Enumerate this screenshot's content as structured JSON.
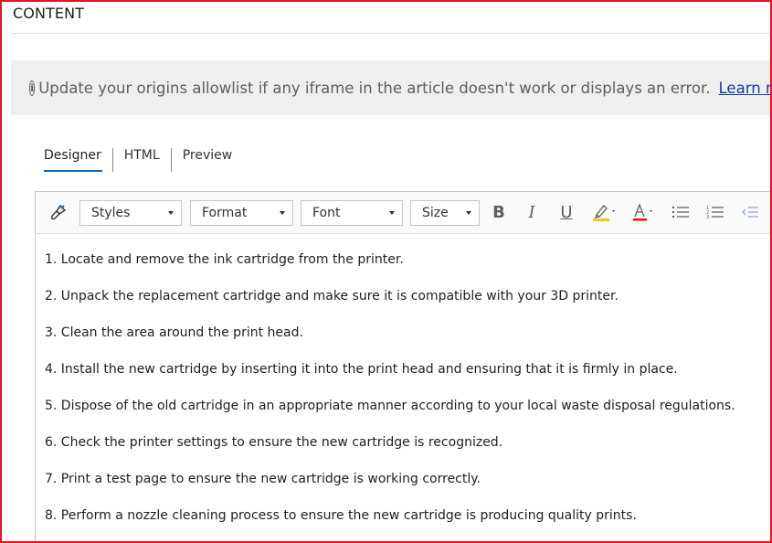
{
  "section": {
    "title": "CONTENT"
  },
  "info_bar": {
    "icon": "info-icon",
    "message": "Update your origins allowlist if any iframe in the article doesn't work or displays an error.",
    "link_text": "Learn more",
    "trailing": "."
  },
  "tabs": [
    {
      "label": "Designer",
      "active": true
    },
    {
      "label": "HTML",
      "active": false
    },
    {
      "label": "Preview",
      "active": false
    }
  ],
  "toolbar": {
    "format_painter_icon": "brush-icon",
    "styles_label": "Styles",
    "format_label": "Format",
    "font_label": "Font",
    "size_label": "Size",
    "bold_label": "B",
    "italic_label": "I",
    "underline_label": "U",
    "highlight_icon": "highlight-icon",
    "font_color_label": "A",
    "bulleted_list_icon": "bulleted-list-icon",
    "numbered_list_icon": "numbered-list-icon",
    "decrease_indent_icon": "decrease-indent-icon",
    "highlight_color": "#f2c811",
    "font_color": "#e81123"
  },
  "content": {
    "lines": [
      "1. Locate and remove the ink cartridge from the printer.",
      "2. Unpack the replacement cartridge and make sure it is compatible with your 3D printer.",
      "3. Clean the area around the print head.",
      "4. Install the new cartridge by inserting it into the print head and ensuring that it is firmly in place.",
      "5. Dispose of the old cartridge in an appropriate manner according to your local waste disposal regulations.",
      "6. Check the printer settings to ensure the new cartridge is recognized.",
      "7. Print a test page to ensure the new cartridge is working correctly.",
      "8. Perform a nozzle cleaning process to ensure the new cartridge is producing quality prints."
    ]
  },
  "colors": {
    "frame": "#e81123",
    "info_bg": "#efefef",
    "link": "#0f3ea8",
    "tab_underline": "#0f6cbd"
  }
}
